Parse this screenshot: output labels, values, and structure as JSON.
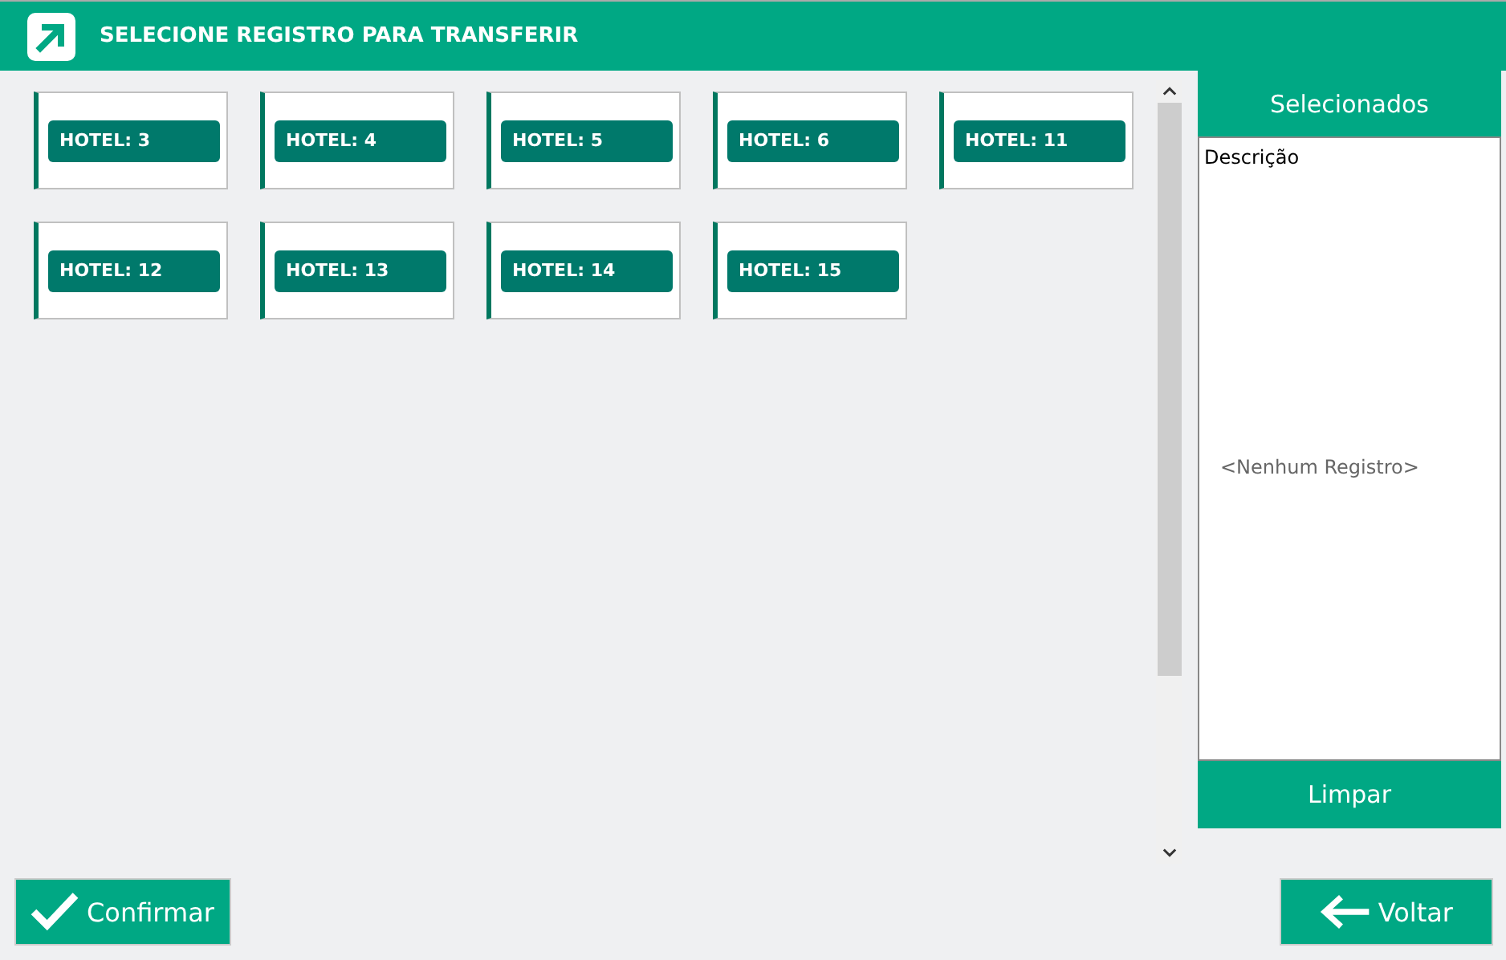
{
  "window": {
    "title": "SELECIONE REGISTRO PARA TRANSFERIR"
  },
  "records": [
    {
      "label": "HOTEL: 3"
    },
    {
      "label": "HOTEL: 4"
    },
    {
      "label": "HOTEL: 5"
    },
    {
      "label": "HOTEL: 6"
    },
    {
      "label": "HOTEL: 11"
    },
    {
      "label": "HOTEL: 12"
    },
    {
      "label": "HOTEL: 13"
    },
    {
      "label": "HOTEL: 14"
    },
    {
      "label": "HOTEL: 15"
    }
  ],
  "selected_panel": {
    "title": "Selecionados",
    "column": "Descrição",
    "empty_text": "<Nenhum Registro>",
    "clear_button": "Limpar"
  },
  "buttons": {
    "confirm": "Confirmar",
    "back": "Voltar"
  }
}
